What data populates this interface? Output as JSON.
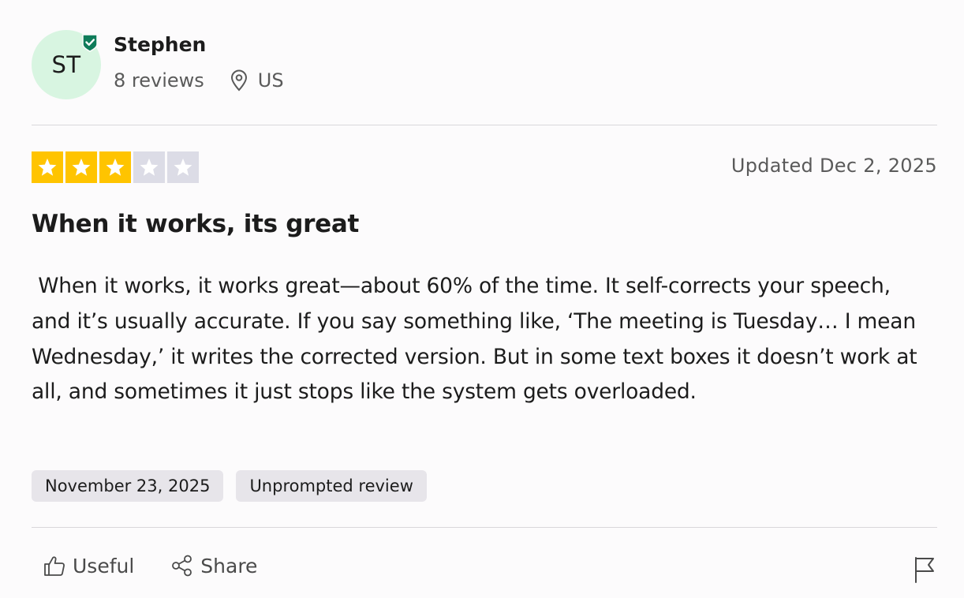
{
  "reviewer": {
    "initials": "ST",
    "name": "Stephen",
    "reviews_count": "8 reviews",
    "location": "US",
    "verified_icon": "verified-check-icon",
    "avatar_bg": "#d8f5e1",
    "verified_color": "#0f7c5a"
  },
  "rating": {
    "stars": 3,
    "max": 5,
    "star_on_color": "#ffc400",
    "star_off_color": "#dcdce6"
  },
  "review": {
    "updated_date": "Updated Dec 2, 2025",
    "title": "When it works, its great",
    "body": " When it works, it works great—about 60% of the time. It self-corrects your speech, and it’s usually accurate. If you say something like, ‘The meeting is Tuesday… I mean Wednesday,’ it writes the corrected version. But in some text boxes it doesn’t work at all, and sometimes it just stops like the system gets overloaded.",
    "tags": [
      "November 23, 2025",
      "Unprompted review"
    ]
  },
  "actions": {
    "useful_label": "Useful",
    "useful_icon": "thumbs-up-icon",
    "share_label": "Share",
    "share_icon": "share-icon",
    "report_icon": "flag-icon"
  }
}
